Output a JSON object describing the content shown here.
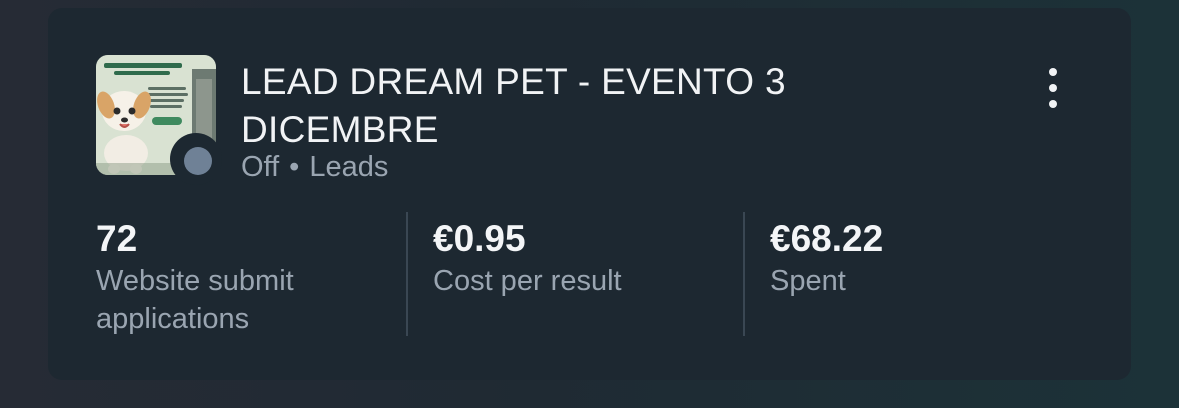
{
  "campaign": {
    "title": "LEAD DREAM PET - EVENTO 3 DICEMBRE",
    "status": "Off",
    "separator": "•",
    "objective": "Leads",
    "thumbnail_icon": "ad-creative-thumbnail-puppy",
    "status_dot_color": "#6f8196",
    "more_icon": "more-vertical-icon"
  },
  "metrics": [
    {
      "value": "72",
      "label": "Website submit applications"
    },
    {
      "value": "€0.95",
      "label": "Cost per result"
    },
    {
      "value": "€68.22",
      "label": "Spent"
    }
  ]
}
